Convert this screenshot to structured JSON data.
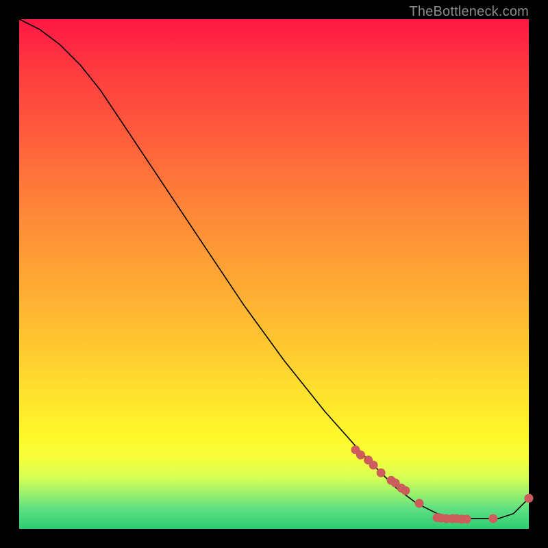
{
  "watermark": "TheBottleneck.com",
  "chart_data": {
    "type": "line",
    "title": "",
    "xlabel": "",
    "ylabel": "",
    "xlim": [
      0,
      100
    ],
    "ylim": [
      0,
      100
    ],
    "series": [
      {
        "name": "curve",
        "x": [
          0,
          4,
          8,
          12,
          16,
          20,
          28,
          36,
          44,
          52,
          60,
          68,
          74,
          78,
          82,
          86,
          90,
          94,
          97,
          100
        ],
        "y": [
          100,
          98,
          95,
          91,
          86,
          80,
          68,
          56,
          44,
          33,
          23,
          14,
          8,
          5,
          3,
          2,
          2,
          2,
          3,
          6
        ]
      }
    ],
    "markers": {
      "name": "dots",
      "x": [
        66,
        67,
        68.5,
        69.5,
        71,
        73,
        73.8,
        75,
        75.8,
        78.5,
        82,
        82.8,
        83.8,
        85,
        85.8,
        86.8,
        87.8,
        93,
        100
      ],
      "y": [
        15.5,
        14.5,
        13.5,
        12.5,
        11,
        9.5,
        9,
        8,
        7.5,
        5,
        2.2,
        2.1,
        2.0,
        2.0,
        2.0,
        1.9,
        1.9,
        2.0,
        6
      ]
    },
    "background_gradient": {
      "orientation": "vertical",
      "stops": [
        {
          "pos": 0.0,
          "color": "#ff1744"
        },
        {
          "pos": 0.1,
          "color": "#ff3b3f"
        },
        {
          "pos": 0.22,
          "color": "#ff5a3c"
        },
        {
          "pos": 0.33,
          "color": "#ff7a39"
        },
        {
          "pos": 0.44,
          "color": "#ff9636"
        },
        {
          "pos": 0.55,
          "color": "#ffb133"
        },
        {
          "pos": 0.66,
          "color": "#ffcc30"
        },
        {
          "pos": 0.75,
          "color": "#ffe62d"
        },
        {
          "pos": 0.82,
          "color": "#fff82a"
        },
        {
          "pos": 0.86,
          "color": "#f7ff3a"
        },
        {
          "pos": 0.9,
          "color": "#d6ff55"
        },
        {
          "pos": 0.93,
          "color": "#9cf26c"
        },
        {
          "pos": 0.96,
          "color": "#5fe082"
        },
        {
          "pos": 1.0,
          "color": "#2ecc71"
        }
      ]
    }
  }
}
